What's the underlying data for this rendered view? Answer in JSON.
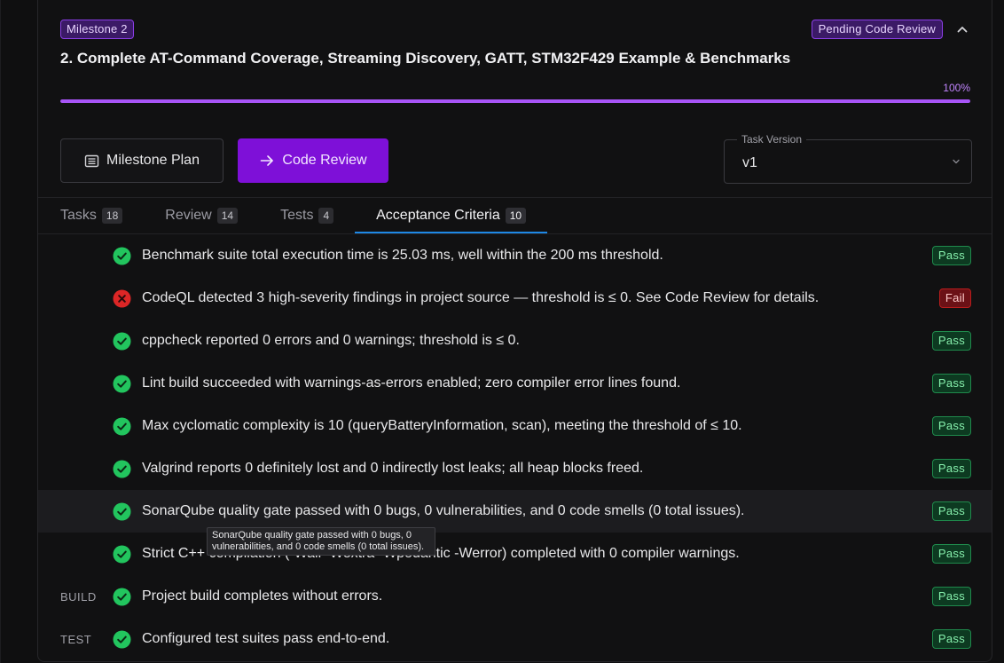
{
  "milestone": {
    "badge": "Milestone 2",
    "status": "Pending Code Review",
    "title": "2. Complete AT-Command Coverage, Streaming Discovery, GATT, STM32F429 Example & Benchmarks",
    "progress_label": "100%",
    "progress_value": 100
  },
  "actions": {
    "plan_label": "Milestone Plan",
    "review_label": "Code Review"
  },
  "task_version": {
    "label": "Task Version",
    "value": "v1"
  },
  "tabs": [
    {
      "label": "Tasks",
      "count": "18"
    },
    {
      "label": "Review",
      "count": "14"
    },
    {
      "label": "Tests",
      "count": "4"
    },
    {
      "label": "Acceptance Criteria",
      "count": "10"
    }
  ],
  "criteria": [
    {
      "category": "",
      "text": "Benchmark suite total execution time is 25.03 ms, well within the 200 ms threshold.",
      "status": "Pass"
    },
    {
      "category": "",
      "text": "CodeQL detected 3 high-severity findings in project source — threshold is ≤ 0. See Code Review for details.",
      "status": "Fail"
    },
    {
      "category": "",
      "text": "cppcheck reported 0 errors and 0 warnings; threshold is ≤ 0.",
      "status": "Pass"
    },
    {
      "category": "",
      "text": "Lint build succeeded with warnings-as-errors enabled; zero compiler error lines found.",
      "status": "Pass"
    },
    {
      "category": "",
      "text": "Max cyclomatic complexity is 10 (queryBatteryInformation, scan), meeting the threshold of ≤ 10.",
      "status": "Pass"
    },
    {
      "category": "",
      "text": "Valgrind reports 0 definitely lost and 0 indirectly lost leaks; all heap blocks freed.",
      "status": "Pass"
    },
    {
      "category": "",
      "text": "SonarQube quality gate passed with 0 bugs, 0 vulnerabilities, and 0 code smells (0 total issues).",
      "status": "Pass"
    },
    {
      "category": "",
      "text": "Strict C++ compilation (-Wall -Wextra -Wpedantic -Werror) completed with 0 compiler warnings.",
      "status": "Pass"
    },
    {
      "category": "BUILD",
      "text": "Project build completes without errors.",
      "status": "Pass"
    },
    {
      "category": "TEST",
      "text": "Configured test suites pass end-to-end.",
      "status": "Pass"
    }
  ],
  "tooltip": {
    "text": "SonarQube quality gate passed with 0 bugs, 0 vulnerabilities, and 0 code smells (0 total issues)."
  },
  "colors": {
    "accent": "#7e10d8",
    "progress": "#a855f7",
    "pass": "#22c55e",
    "fail": "#dc2626",
    "tab_underline": "#1e88e5"
  }
}
